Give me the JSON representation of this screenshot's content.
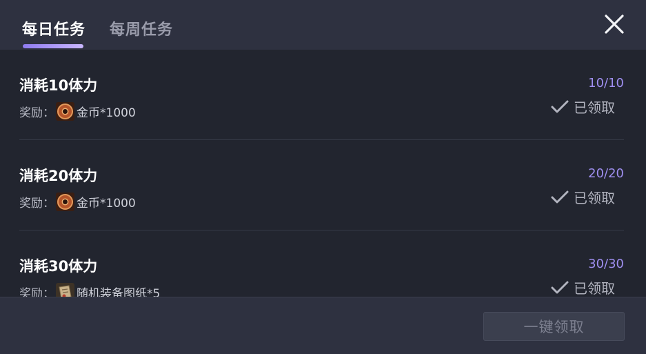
{
  "tabs": [
    {
      "label": "每日任务",
      "active": true
    },
    {
      "label": "每周任务",
      "active": false
    }
  ],
  "accent_color": "#9f8ff0",
  "tasks": [
    {
      "title": "消耗10体力",
      "reward_label": "奖励：",
      "reward_icon": "gold-coin-icon",
      "reward_text": "金币*1000",
      "progress": "10/10",
      "status": "已领取"
    },
    {
      "title": "消耗20体力",
      "reward_label": "奖励：",
      "reward_icon": "gold-coin-icon",
      "reward_text": "金币*1000",
      "progress": "20/20",
      "status": "已领取"
    },
    {
      "title": "消耗30体力",
      "reward_label": "奖励：",
      "reward_icon": "blueprint-scroll-icon",
      "reward_text": "随机装备图纸*5",
      "progress": "30/30",
      "status": "已领取"
    }
  ],
  "footer": {
    "claim_all_label": "一键领取",
    "claim_all_enabled": false
  }
}
